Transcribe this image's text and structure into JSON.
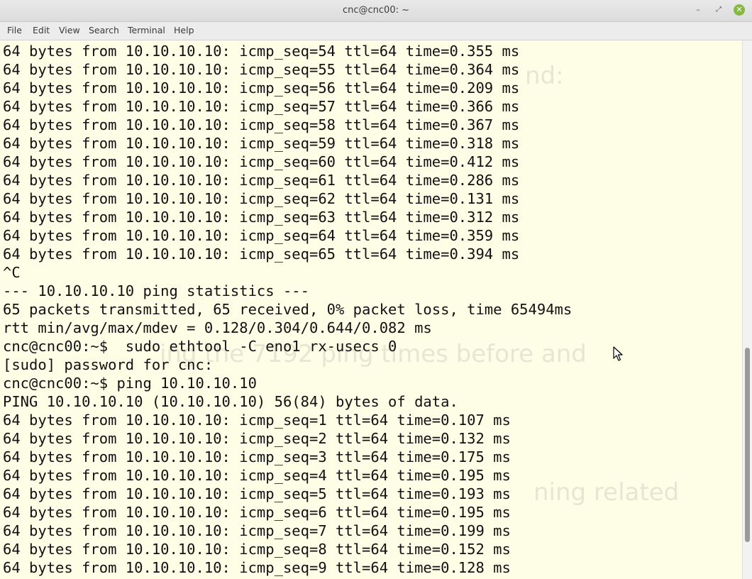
{
  "window": {
    "title": "cnc@cnc00: ~",
    "controls": {
      "minimize": "–",
      "maximize": "⤢",
      "close": "✕"
    }
  },
  "menubar": {
    "items": [
      "File",
      "Edit",
      "View",
      "Search",
      "Terminal",
      "Help"
    ]
  },
  "terminal": {
    "lines": [
      "64 bytes from 10.10.10.10: icmp_seq=54 ttl=64 time=0.355 ms",
      "64 bytes from 10.10.10.10: icmp_seq=55 ttl=64 time=0.364 ms",
      "64 bytes from 10.10.10.10: icmp_seq=56 ttl=64 time=0.209 ms",
      "64 bytes from 10.10.10.10: icmp_seq=57 ttl=64 time=0.366 ms",
      "64 bytes from 10.10.10.10: icmp_seq=58 ttl=64 time=0.367 ms",
      "64 bytes from 10.10.10.10: icmp_seq=59 ttl=64 time=0.318 ms",
      "64 bytes from 10.10.10.10: icmp_seq=60 ttl=64 time=0.412 ms",
      "64 bytes from 10.10.10.10: icmp_seq=61 ttl=64 time=0.286 ms",
      "64 bytes from 10.10.10.10: icmp_seq=62 ttl=64 time=0.131 ms",
      "64 bytes from 10.10.10.10: icmp_seq=63 ttl=64 time=0.312 ms",
      "64 bytes from 10.10.10.10: icmp_seq=64 ttl=64 time=0.359 ms",
      "64 bytes from 10.10.10.10: icmp_seq=65 ttl=64 time=0.394 ms",
      "^C",
      "--- 10.10.10.10 ping statistics ---",
      "65 packets transmitted, 65 received, 0% packet loss, time 65494ms",
      "rtt min/avg/max/mdev = 0.128/0.304/0.644/0.082 ms",
      "cnc@cnc00:~$  sudo ethtool -C eno1 rx-usecs 0",
      "[sudo] password for cnc:",
      "cnc@cnc00:~$ ping 10.10.10.10",
      "PING 10.10.10.10 (10.10.10.10) 56(84) bytes of data.",
      "64 bytes from 10.10.10.10: icmp_seq=1 ttl=64 time=0.107 ms",
      "64 bytes from 10.10.10.10: icmp_seq=2 ttl=64 time=0.132 ms",
      "64 bytes from 10.10.10.10: icmp_seq=3 ttl=64 time=0.175 ms",
      "64 bytes from 10.10.10.10: icmp_seq=4 ttl=64 time=0.195 ms",
      "64 bytes from 10.10.10.10: icmp_seq=5 ttl=64 time=0.193 ms",
      "64 bytes from 10.10.10.10: icmp_seq=6 ttl=64 time=0.195 ms",
      "64 bytes from 10.10.10.10: icmp_seq=7 ttl=64 time=0.199 ms",
      "64 bytes from 10.10.10.10: icmp_seq=8 ttl=64 time=0.152 ms",
      "64 bytes from 10.10.10.10: icmp_seq=9 ttl=64 time=0.128 ms"
    ],
    "ghost_text": [
      "nd:",
      "ing the 7192 ping times before and",
      "ning related"
    ]
  },
  "colors": {
    "terminal_bg": "#fefde6",
    "terminal_fg": "#111111",
    "close_button": "#86b842"
  },
  "icons": {
    "pointer": "mouse-pointer-icon"
  }
}
